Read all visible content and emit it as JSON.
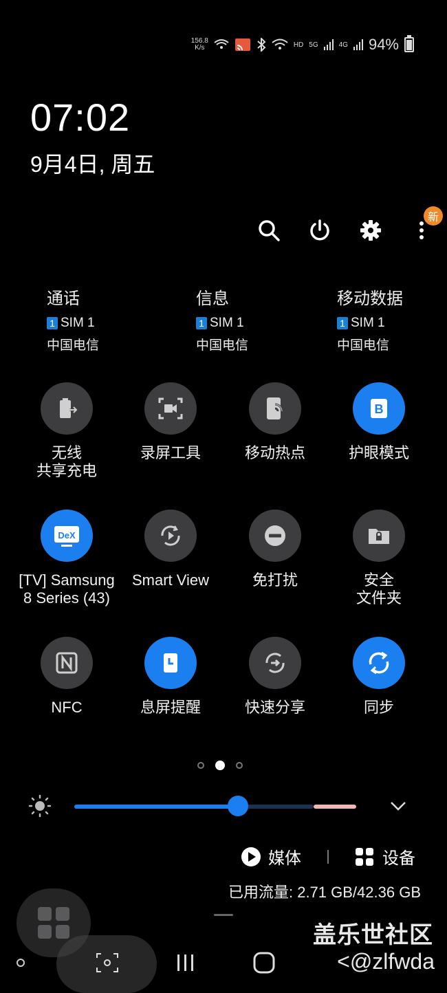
{
  "status_bar": {
    "net_speed_value": "156.8",
    "net_speed_unit": "K/s",
    "hd_label": "HD",
    "net_5g": "5G",
    "net_4g": "4G",
    "battery": "94%"
  },
  "lock": {
    "time": "07:02",
    "date": "9月4日, 周五"
  },
  "actions": {
    "new_badge": "新"
  },
  "sims": [
    {
      "title": "通话",
      "sim_num": "1",
      "sim_label": "SIM 1",
      "carrier": "中国电信"
    },
    {
      "title": "信息",
      "sim_num": "1",
      "sim_label": "SIM 1",
      "carrier": "中国电信"
    },
    {
      "title": "移动数据",
      "sim_num": "1",
      "sim_label": "SIM 1",
      "carrier": "中国电信"
    }
  ],
  "tiles": [
    {
      "label": "无线\n共享充电",
      "icon": "wireless-powershare-icon",
      "on": false
    },
    {
      "label": "录屏工具",
      "icon": "screen-recorder-icon",
      "on": false
    },
    {
      "label": "移动热点",
      "icon": "mobile-hotspot-icon",
      "on": false
    },
    {
      "label": "护眼模式",
      "icon": "eye-comfort-icon",
      "on": true
    },
    {
      "label": "[TV] Samsung\n8 Series (43)",
      "icon": "dex-icon",
      "on": true
    },
    {
      "label": "Smart View",
      "icon": "smart-view-icon",
      "on": false
    },
    {
      "label": "免打扰",
      "icon": "do-not-disturb-icon",
      "on": false
    },
    {
      "label": "安全\n文件夹",
      "icon": "secure-folder-icon",
      "on": false
    },
    {
      "label": "NFC",
      "icon": "nfc-icon",
      "on": false
    },
    {
      "label": "息屏提醒",
      "icon": "always-on-display-icon",
      "on": true
    },
    {
      "label": "快速分享",
      "icon": "quick-share-icon",
      "on": false
    },
    {
      "label": "同步",
      "icon": "sync-icon",
      "on": true
    }
  ],
  "pager": {
    "pages": 3,
    "current": 2
  },
  "brightness": {
    "level": 0.58
  },
  "media": {
    "media_label": "媒体",
    "devices_label": "设备"
  },
  "data_usage": "已用流量: 2.71 GB/42.36 GB",
  "watermark": {
    "site": "盖乐世社区",
    "user": "<@zlfwda"
  },
  "colors": {
    "accent": "#1b7ff0",
    "tile_off": "#3d3d3f",
    "badge": "#f08a28"
  }
}
